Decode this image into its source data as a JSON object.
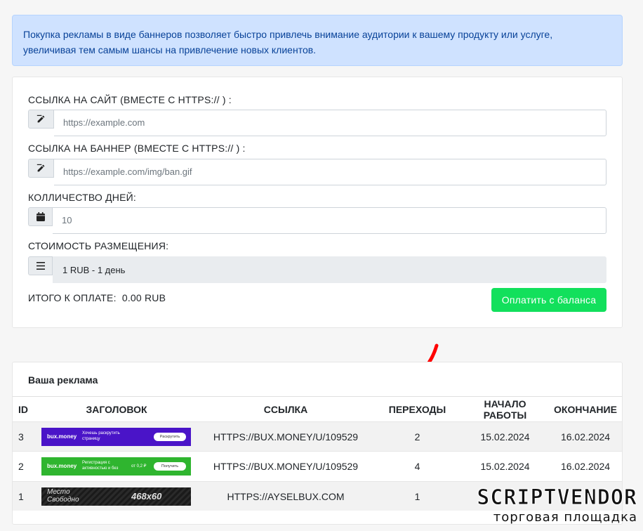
{
  "alert": {
    "line1": "Покупка рекламы в виде баннеров позволяет быстро привлечь внимание аудитории к вашему продукту или услуге,",
    "line2": "увеличивая тем самым шансы на привлечение новых клиентов."
  },
  "form": {
    "site_label": "ССЫЛКА НА САЙТ (ВМЕСТЕ С HTTPS:// ) :",
    "site_placeholder": "https://example.com",
    "banner_label": "ССЫЛКА НА БАННЕР (ВМЕСТЕ С HTTPS:// ) :",
    "banner_placeholder": "https://example.com/img/ban.gif",
    "days_label": "КОЛЛИЧЕСТВО ДНЕЙ:",
    "days_value": "10",
    "price_label": "СТОИМОСТЬ РАЗМЕЩЕНИЯ:",
    "price_value": "1 RUB - 1 день",
    "total_label": "ИТОГО К ОПЛАТЕ:",
    "total_value": "0.00 RUB",
    "pay_button": "Оплатить с баланса"
  },
  "ads": {
    "title": "Ваша реклама",
    "columns": [
      "ID",
      "ЗАГОЛОВОК",
      "ССЫЛКА",
      "ПЕРЕХОДЫ",
      "НАЧАЛО РАБОТЫ",
      "ОКОНЧАНИЕ"
    ],
    "rows": [
      {
        "id": "3",
        "banner": {
          "brand": "bux.money",
          "text": "Хочешь раскрутить страницу",
          "button": "Раскрутить"
        },
        "link": "HTTPS://BUX.MONEY/U/109529",
        "clicks": "2",
        "start": "15.02.2024",
        "end": "16.02.2024"
      },
      {
        "id": "2",
        "banner": {
          "brand": "bux.money",
          "text": "Регистрация с активностью и без",
          "sum": "от 0,2 ₽",
          "button": "Получить"
        },
        "link": "HTTPS://BUX.MONEY/U/109529",
        "clicks": "4",
        "start": "15.02.2024",
        "end": "16.02.2024"
      },
      {
        "id": "1",
        "banner": {
          "line1": "Место",
          "line2": "Свободно",
          "size": "468x60"
        },
        "link": "HTTPS://AYSELBUX.COM",
        "clicks": "1",
        "start": "",
        "end": ""
      }
    ]
  },
  "watermark": {
    "big": "SCRIPTVENDOR",
    "small": "торговая площадка"
  },
  "colors": {
    "alert_bg": "#cfe2ff",
    "pay_button": "#12e05c",
    "arrow": "#ff0000"
  },
  "icons": [
    "edit-icon",
    "edit-icon",
    "calendar-icon",
    "list-icon",
    "arrow-annotation"
  ]
}
